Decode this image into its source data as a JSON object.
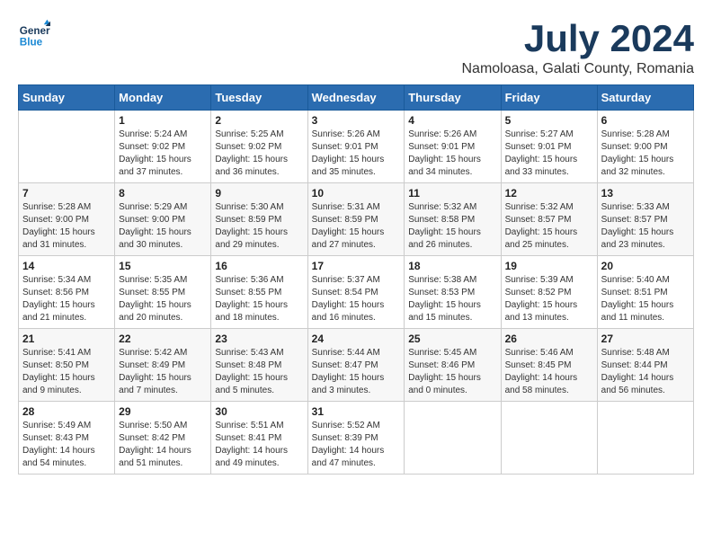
{
  "header": {
    "logo_line1": "General",
    "logo_line2": "Blue",
    "month": "July 2024",
    "location": "Namoloasa, Galati County, Romania"
  },
  "weekdays": [
    "Sunday",
    "Monday",
    "Tuesday",
    "Wednesday",
    "Thursday",
    "Friday",
    "Saturday"
  ],
  "weeks": [
    [
      {
        "day": "",
        "info": ""
      },
      {
        "day": "1",
        "info": "Sunrise: 5:24 AM\nSunset: 9:02 PM\nDaylight: 15 hours\nand 37 minutes."
      },
      {
        "day": "2",
        "info": "Sunrise: 5:25 AM\nSunset: 9:02 PM\nDaylight: 15 hours\nand 36 minutes."
      },
      {
        "day": "3",
        "info": "Sunrise: 5:26 AM\nSunset: 9:01 PM\nDaylight: 15 hours\nand 35 minutes."
      },
      {
        "day": "4",
        "info": "Sunrise: 5:26 AM\nSunset: 9:01 PM\nDaylight: 15 hours\nand 34 minutes."
      },
      {
        "day": "5",
        "info": "Sunrise: 5:27 AM\nSunset: 9:01 PM\nDaylight: 15 hours\nand 33 minutes."
      },
      {
        "day": "6",
        "info": "Sunrise: 5:28 AM\nSunset: 9:00 PM\nDaylight: 15 hours\nand 32 minutes."
      }
    ],
    [
      {
        "day": "7",
        "info": "Sunrise: 5:28 AM\nSunset: 9:00 PM\nDaylight: 15 hours\nand 31 minutes."
      },
      {
        "day": "8",
        "info": "Sunrise: 5:29 AM\nSunset: 9:00 PM\nDaylight: 15 hours\nand 30 minutes."
      },
      {
        "day": "9",
        "info": "Sunrise: 5:30 AM\nSunset: 8:59 PM\nDaylight: 15 hours\nand 29 minutes."
      },
      {
        "day": "10",
        "info": "Sunrise: 5:31 AM\nSunset: 8:59 PM\nDaylight: 15 hours\nand 27 minutes."
      },
      {
        "day": "11",
        "info": "Sunrise: 5:32 AM\nSunset: 8:58 PM\nDaylight: 15 hours\nand 26 minutes."
      },
      {
        "day": "12",
        "info": "Sunrise: 5:32 AM\nSunset: 8:57 PM\nDaylight: 15 hours\nand 25 minutes."
      },
      {
        "day": "13",
        "info": "Sunrise: 5:33 AM\nSunset: 8:57 PM\nDaylight: 15 hours\nand 23 minutes."
      }
    ],
    [
      {
        "day": "14",
        "info": "Sunrise: 5:34 AM\nSunset: 8:56 PM\nDaylight: 15 hours\nand 21 minutes."
      },
      {
        "day": "15",
        "info": "Sunrise: 5:35 AM\nSunset: 8:55 PM\nDaylight: 15 hours\nand 20 minutes."
      },
      {
        "day": "16",
        "info": "Sunrise: 5:36 AM\nSunset: 8:55 PM\nDaylight: 15 hours\nand 18 minutes."
      },
      {
        "day": "17",
        "info": "Sunrise: 5:37 AM\nSunset: 8:54 PM\nDaylight: 15 hours\nand 16 minutes."
      },
      {
        "day": "18",
        "info": "Sunrise: 5:38 AM\nSunset: 8:53 PM\nDaylight: 15 hours\nand 15 minutes."
      },
      {
        "day": "19",
        "info": "Sunrise: 5:39 AM\nSunset: 8:52 PM\nDaylight: 15 hours\nand 13 minutes."
      },
      {
        "day": "20",
        "info": "Sunrise: 5:40 AM\nSunset: 8:51 PM\nDaylight: 15 hours\nand 11 minutes."
      }
    ],
    [
      {
        "day": "21",
        "info": "Sunrise: 5:41 AM\nSunset: 8:50 PM\nDaylight: 15 hours\nand 9 minutes."
      },
      {
        "day": "22",
        "info": "Sunrise: 5:42 AM\nSunset: 8:49 PM\nDaylight: 15 hours\nand 7 minutes."
      },
      {
        "day": "23",
        "info": "Sunrise: 5:43 AM\nSunset: 8:48 PM\nDaylight: 15 hours\nand 5 minutes."
      },
      {
        "day": "24",
        "info": "Sunrise: 5:44 AM\nSunset: 8:47 PM\nDaylight: 15 hours\nand 3 minutes."
      },
      {
        "day": "25",
        "info": "Sunrise: 5:45 AM\nSunset: 8:46 PM\nDaylight: 15 hours\nand 0 minutes."
      },
      {
        "day": "26",
        "info": "Sunrise: 5:46 AM\nSunset: 8:45 PM\nDaylight: 14 hours\nand 58 minutes."
      },
      {
        "day": "27",
        "info": "Sunrise: 5:48 AM\nSunset: 8:44 PM\nDaylight: 14 hours\nand 56 minutes."
      }
    ],
    [
      {
        "day": "28",
        "info": "Sunrise: 5:49 AM\nSunset: 8:43 PM\nDaylight: 14 hours\nand 54 minutes."
      },
      {
        "day": "29",
        "info": "Sunrise: 5:50 AM\nSunset: 8:42 PM\nDaylight: 14 hours\nand 51 minutes."
      },
      {
        "day": "30",
        "info": "Sunrise: 5:51 AM\nSunset: 8:41 PM\nDaylight: 14 hours\nand 49 minutes."
      },
      {
        "day": "31",
        "info": "Sunrise: 5:52 AM\nSunset: 8:39 PM\nDaylight: 14 hours\nand 47 minutes."
      },
      {
        "day": "",
        "info": ""
      },
      {
        "day": "",
        "info": ""
      },
      {
        "day": "",
        "info": ""
      }
    ]
  ]
}
